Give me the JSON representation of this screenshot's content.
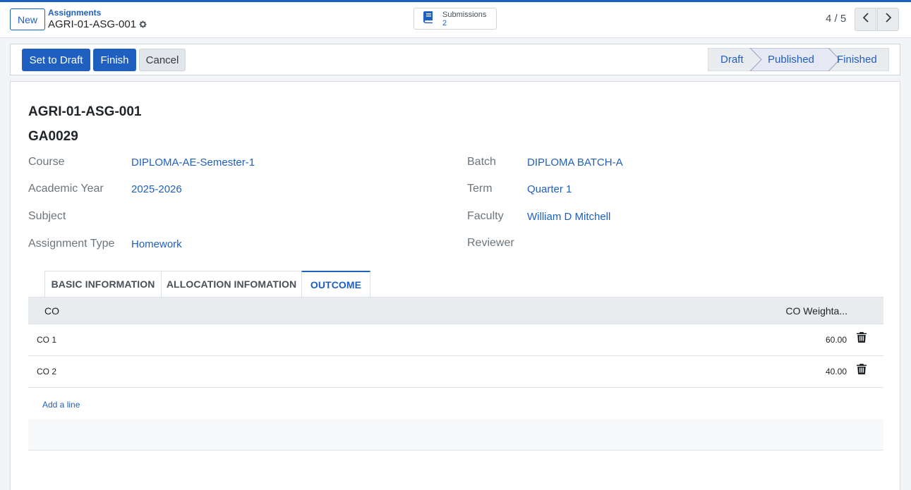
{
  "control_panel": {
    "new_label": "New",
    "breadcrumb_parent": "Assignments",
    "breadcrumb_current": "AGRI-01-ASG-001",
    "stat_button": {
      "label": "Submissions",
      "value": "2",
      "icon": "book-icon"
    },
    "pager": "4 / 5"
  },
  "statusbar": {
    "buttons": [
      "Set to Draft",
      "Finish",
      "Cancel"
    ],
    "stages": [
      "Draft",
      "Published",
      "Finished"
    ],
    "active_stage": "Published"
  },
  "record": {
    "title": "AGRI-01-ASG-001",
    "code": "GA0029",
    "fields_left": [
      {
        "label": "Course",
        "value": "DIPLOMA-AE-Semester-1"
      },
      {
        "label": "Academic Year",
        "value": "2025-2026"
      },
      {
        "label": "Subject",
        "value": ""
      },
      {
        "label": "Assignment Type",
        "value": "Homework"
      }
    ],
    "fields_right": [
      {
        "label": "Batch",
        "value": "DIPLOMA BATCH-A"
      },
      {
        "label": "Term",
        "value": "Quarter 1"
      },
      {
        "label": "Faculty",
        "value": "William D Mitchell"
      },
      {
        "label": "Reviewer",
        "value": ""
      }
    ]
  },
  "tabs": [
    "BASIC INFORMATION",
    "ALLOCATION INFOMATION",
    "OUTCOME"
  ],
  "active_tab": "OUTCOME",
  "outcome_table": {
    "columns": [
      "CO",
      "CO Weighta..."
    ],
    "rows": [
      {
        "co": "CO 1",
        "weight": "60.00"
      },
      {
        "co": "CO 2",
        "weight": "40.00"
      }
    ],
    "add_line": "Add a line"
  },
  "colors": {
    "brand": "#1f5fbf",
    "stage_active_bg": "#e6e8f4",
    "stage_bg": "#e9ecef"
  }
}
